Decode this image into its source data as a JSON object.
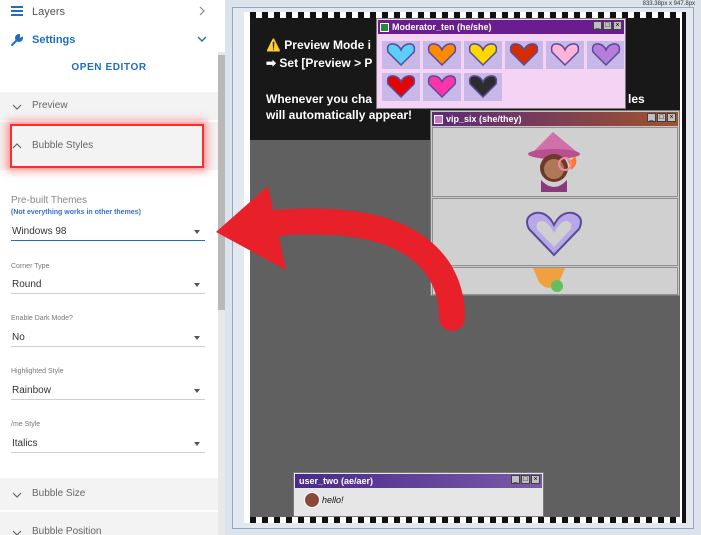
{
  "sidebar": {
    "layers_label": "Layers",
    "settings_label": "Settings",
    "open_editor_label": "OPEN EDITOR",
    "sections": {
      "preview": "Preview",
      "bubble_styles": "Bubble Styles",
      "bubble_size": "Bubble Size",
      "bubble_position": "Bubble Position"
    },
    "fields": {
      "prebuilt_themes": {
        "label": "Pre-built Themes",
        "note": "(Not everything works in other themes)",
        "value": "Windows 98"
      },
      "corner_type": {
        "label": "Corner Type",
        "value": "Round"
      },
      "dark_mode": {
        "label": "Enable Dark Mode?",
        "value": "No"
      },
      "highlighted_style": {
        "label": "Highlighted Style",
        "value": "Rainbow"
      },
      "me_style": {
        "label": "/me Style",
        "value": "Italics"
      }
    }
  },
  "preview": {
    "size_readout": "833.38px x 947.8px",
    "notice": {
      "line1": "⚠️ Preview Mode i",
      "line2": "➡ Set [Preview > P",
      "line3": "Whenever you cha",
      "line3_tail": "les",
      "line4": "will automatically appear!"
    },
    "bubbles": {
      "moderator": {
        "title": "Moderator_ten (he/she)",
        "icon": "sword-icon"
      },
      "vip": {
        "title": "vip_six (she/they)",
        "icon": "heart-gem-icon"
      },
      "user": {
        "title": "user_two (ae/aer)",
        "message": "hello!"
      }
    },
    "window_buttons": [
      "_",
      "□",
      "×"
    ],
    "emote_colors": [
      "#5bcefa",
      "#ff8a00",
      "#ffd800",
      "#d52d00",
      "#ffb3d9",
      "#b57edc",
      "#e40303",
      "#ff33aa",
      "#2d2d2d"
    ]
  },
  "accent_color": "#1e6fc1",
  "highlight_color": "#ff2b2b"
}
